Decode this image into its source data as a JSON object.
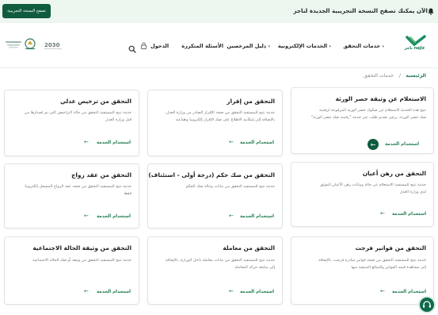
{
  "banner": {
    "button_label": "تصفح النسخة التجريبية",
    "text": "الآن يمكنك تصفح النسخة التجريبية الجديدة لناجز"
  },
  "nav": {
    "items": [
      {
        "label": "خدمات التحقق"
      },
      {
        "label": "الخدمات الإلكترونية"
      },
      {
        "label": "دليل المرخصين"
      },
      {
        "label": "الأسئلة المتكررة"
      }
    ],
    "login": "الدخول",
    "logo_text": "ناجز najiz",
    "vision": "2030"
  },
  "breadcrumb": {
    "home": "الرئيسية",
    "separator": "/",
    "current": "خدمات التحقق"
  },
  "cards": [
    {
      "title": "الاستعلام عن وثيقة حصر الورثة",
      "desc": [
        "تتيح هذه الخدمة الاستعلام عن صكوك حصر الورثة المرفوعة لرقمنة",
        "صك حصر الورثة، يرجى تقديم طلب عبر خدمة \"رقمنة صك حصر الورثة\""
      ],
      "link": "استخدام الخدمة"
    },
    {
      "title": "التحقق من إقرار",
      "desc": [
        "خدمة تتيح للمستفيد التحقق من صحة الإقرار الصادر من وزارة العدل،",
        "بالإضافة إلى إمكانية الاطلاع على صك الإقرار إلكترونيا وطباعته"
      ],
      "link": "استخدام الخدمة"
    },
    {
      "title": "التحقق من ترخيص عدلي",
      "desc": [
        "خدمة تتيح للمستفيد التحقق من حالة التراخيص التي تم إصدارها من",
        "قبل وزارة العدل"
      ],
      "link": "استخدام الخدمة"
    },
    {
      "title": "التحقق من رهن أعيان",
      "desc": [
        "خدمة تتيح للمستفيد الاستعلام عن حالة وبيانات رهن الأعيان الموثق",
        "لدى وزارة العدل"
      ],
      "link": "استخدام الخدمة"
    },
    {
      "title": "التحقق من صك حكم (درجة أولى - استئناف)",
      "desc": [
        "خدمة تتيح للمستفيد التحقق من بيانات وحالة صك الحكم"
      ],
      "link": "استخدام الخدمة"
    },
    {
      "title": "التحقق من عقد زواج",
      "desc": [
        "خدمة تتيح للمستفيد التحقق من صحة عقد الزواج المسجل إلكترونيا",
        "فقط"
      ],
      "link": "استخدام الخدمة"
    },
    {
      "title": "التحقق من فواتير فرجت",
      "desc": [
        "خدمة تتيح للمستفيد التحقق من صحة فواتير مبادرة فرجت، بالإضافة",
        "إلى مشاهدة قيمة الفواتير والمبالغ المتبقية منها"
      ],
      "link": "استخدام الخدمة"
    },
    {
      "title": "التحقق من معاملة",
      "desc": [
        "خدمة تتيح للمستفيد التحقق من بيانات معاملة داخل الوزارة، بالإضافة",
        "إلى متابعة حركة المعاملة"
      ],
      "link": "استخدام الخدمة"
    },
    {
      "title": "التحقق من وثيقة الحالة الاجتماعية",
      "desc": [
        "خدمة تتيح للمستفيد التحقق من وثيقة أو صك الحالة الاجتماعية"
      ],
      "link": "استخدام الخدمة"
    }
  ],
  "colors": {
    "brand": "#0f5c3e",
    "accent": "#1f7a50"
  }
}
